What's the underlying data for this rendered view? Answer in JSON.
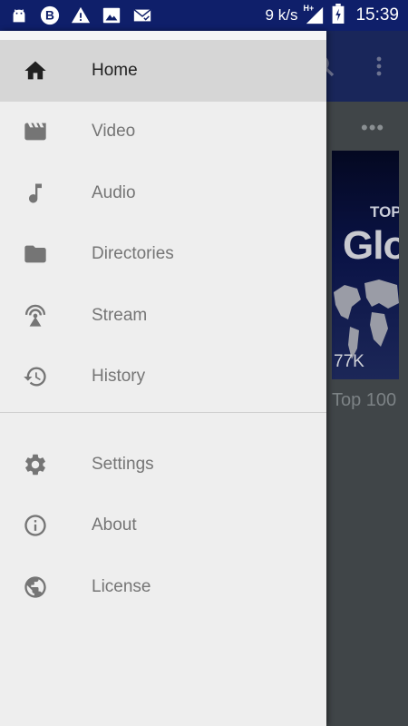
{
  "status_bar": {
    "speed": "9 k/s",
    "network": "H+",
    "time": "15:39",
    "icons": [
      "android-icon",
      "sync-b-icon",
      "warning-icon",
      "image-icon",
      "mail-icon",
      "signal-icon",
      "battery-charging-icon"
    ]
  },
  "drawer": {
    "items": [
      {
        "label": "Home",
        "icon": "home-icon",
        "active": true
      },
      {
        "label": "Video",
        "icon": "video-icon",
        "active": false
      },
      {
        "label": "Audio",
        "icon": "music-note-icon",
        "active": false
      },
      {
        "label": "Directories",
        "icon": "folder-icon",
        "active": false
      },
      {
        "label": "Stream",
        "icon": "stream-antenna-icon",
        "active": false
      },
      {
        "label": "History",
        "icon": "history-icon",
        "active": false
      }
    ],
    "secondary_items": [
      {
        "label": "Settings",
        "icon": "gear-icon"
      },
      {
        "label": "About",
        "icon": "info-icon"
      },
      {
        "label": "License",
        "icon": "globe-icon"
      }
    ]
  },
  "background": {
    "thumbnail_title_top": "TOP",
    "thumbnail_title": "Glo",
    "thumbnail_count": "77K",
    "thumbnail_label": "Top 100"
  },
  "colors": {
    "status_bar": "#0f1f6a",
    "drawer_bg": "#eeeeee",
    "active_item_bg": "#d6d6d6",
    "icon_gray": "#757575"
  }
}
